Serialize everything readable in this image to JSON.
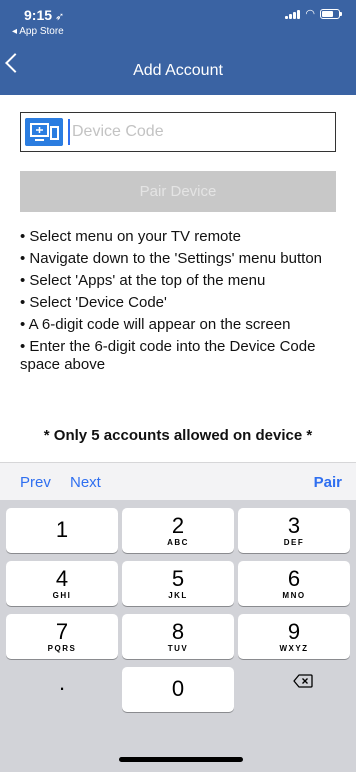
{
  "status_bar": {
    "time": "9:15",
    "back_app": "◂ App Store"
  },
  "nav": {
    "title": "Add Account"
  },
  "device_code": {
    "placeholder": "Device Code"
  },
  "pair_button": {
    "label": "Pair Device"
  },
  "instructions": [
    "• Select menu on your TV remote",
    "• Navigate down to the 'Settings' menu button",
    "• Select 'Apps' at the top of the menu",
    "• Select 'Device Code'",
    "• A 6-digit code will appear on the screen",
    "• Enter the 6-digit code into the Device Code space above"
  ],
  "note": "* Only 5 accounts allowed on device *",
  "accessory_bar": {
    "prev": "Prev",
    "next": "Next",
    "pair": "Pair"
  },
  "keypad": {
    "keys": [
      {
        "num": "1",
        "letters": ""
      },
      {
        "num": "2",
        "letters": "ABC"
      },
      {
        "num": "3",
        "letters": "DEF"
      },
      {
        "num": "4",
        "letters": "GHI"
      },
      {
        "num": "5",
        "letters": "JKL"
      },
      {
        "num": "6",
        "letters": "MNO"
      },
      {
        "num": "7",
        "letters": "PQRS"
      },
      {
        "num": "8",
        "letters": "TUV"
      },
      {
        "num": "9",
        "letters": "WXYZ"
      },
      {
        "num": "0",
        "letters": ""
      }
    ],
    "decimal": "."
  },
  "colors": {
    "header": "#3a63a3",
    "accent": "#2f6ff0",
    "tv_icon": "#2b7de0",
    "disabled_button": "#c8c8c8",
    "keyboard_bg": "#d2d3d8"
  },
  "icons": [
    "location-arrow-icon",
    "back-chevron-icon",
    "signal-icon",
    "wifi-icon",
    "battery-icon",
    "tv-device-icon",
    "backspace-icon"
  ]
}
